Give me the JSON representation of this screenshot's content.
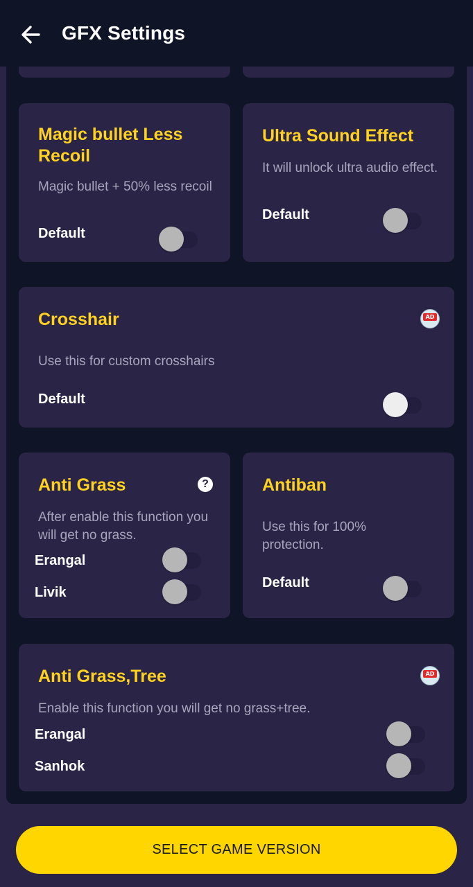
{
  "header": {
    "title": "GFX Settings"
  },
  "cards": {
    "magic_bullet": {
      "title": "Magic bullet Less Recoil",
      "description": "Magic bullet + 50% less recoil",
      "label": "Default"
    },
    "ultra_sound": {
      "title": "Ultra Sound Effect",
      "description": "It will unlock ultra audio effect.",
      "label": "Default"
    },
    "crosshair": {
      "title": "Crosshair",
      "description": "Use this for custom crosshairs",
      "label": "Default",
      "badge": "AD"
    },
    "anti_grass": {
      "title": "Anti Grass",
      "description": "After enable this function you will get no grass.",
      "help": "?",
      "rows": [
        "Erangal",
        "Livik"
      ]
    },
    "antiban": {
      "title": "Antiban",
      "description": "Use this for 100% protection.",
      "label": "Default"
    },
    "anti_grass_tree": {
      "title": "Anti Grass,Tree",
      "description": "Enable this function you will get no grass+tree.",
      "badge": "AD",
      "rows": [
        "Erangal",
        "Sanhok"
      ]
    }
  },
  "cta": {
    "label": "SELECT GAME VERSION"
  },
  "colors": {
    "accent_yellow": "#ffd21f",
    "card_bg": "#2a2447",
    "panel_bg": "#0f1426",
    "button_yellow": "#ffd600"
  }
}
